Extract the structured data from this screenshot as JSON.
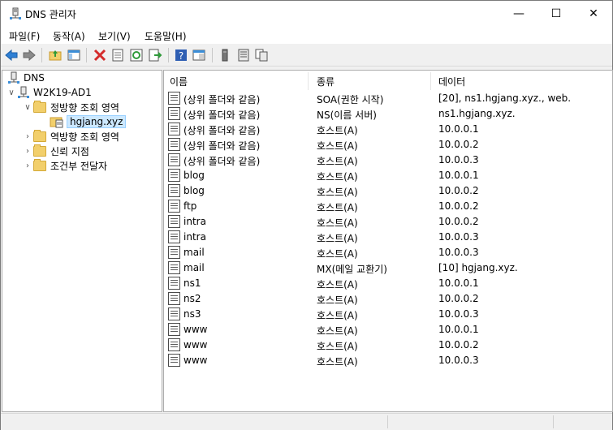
{
  "window": {
    "title": "DNS 관리자",
    "minimize": "—",
    "maximize": "☐",
    "close": "✕"
  },
  "menu": [
    "파일(F)",
    "동작(A)",
    "보기(V)",
    "도움말(H)"
  ],
  "toolbar": [
    "back-arrow-icon",
    "forward-arrow-icon",
    "up-folder-icon",
    "show-hide-tree-icon",
    "delete-icon",
    "properties-icon",
    "refresh-icon",
    "export-icon",
    "help-icon",
    "console-view-icon",
    "server-icon",
    "list-icon",
    "copy-icon"
  ],
  "tree": {
    "root": "DNS",
    "server": "W2K19-AD1",
    "forward": "정방향 조회 영역",
    "zone": "hgjang.xyz",
    "reverse": "역방향 조회 영역",
    "trust": "신뢰 지점",
    "conditional": "조건부 전달자"
  },
  "columns": {
    "name": "이름",
    "type": "종류",
    "data": "데이터"
  },
  "records": [
    {
      "name": "(상위 폴더와 같음)",
      "type": "SOA(권한 시작)",
      "data": "[20], ns1.hgjang.xyz., web."
    },
    {
      "name": "(상위 폴더와 같음)",
      "type": "NS(이름 서버)",
      "data": "ns1.hgjang.xyz."
    },
    {
      "name": "(상위 폴더와 같음)",
      "type": "호스트(A)",
      "data": "10.0.0.1"
    },
    {
      "name": "(상위 폴더와 같음)",
      "type": "호스트(A)",
      "data": "10.0.0.2"
    },
    {
      "name": "(상위 폴더와 같음)",
      "type": "호스트(A)",
      "data": "10.0.0.3"
    },
    {
      "name": "blog",
      "type": "호스트(A)",
      "data": "10.0.0.1"
    },
    {
      "name": "blog",
      "type": "호스트(A)",
      "data": "10.0.0.2"
    },
    {
      "name": "ftp",
      "type": "호스트(A)",
      "data": "10.0.0.2"
    },
    {
      "name": "intra",
      "type": "호스트(A)",
      "data": "10.0.0.2"
    },
    {
      "name": "intra",
      "type": "호스트(A)",
      "data": "10.0.0.3"
    },
    {
      "name": "mail",
      "type": "호스트(A)",
      "data": "10.0.0.3"
    },
    {
      "name": "mail",
      "type": "MX(메일 교환기)",
      "data": "[10]  hgjang.xyz."
    },
    {
      "name": "ns1",
      "type": "호스트(A)",
      "data": "10.0.0.1"
    },
    {
      "name": "ns2",
      "type": "호스트(A)",
      "data": "10.0.0.2"
    },
    {
      "name": "ns3",
      "type": "호스트(A)",
      "data": "10.0.0.3"
    },
    {
      "name": "www",
      "type": "호스트(A)",
      "data": "10.0.0.1"
    },
    {
      "name": "www",
      "type": "호스트(A)",
      "data": "10.0.0.2"
    },
    {
      "name": "www",
      "type": "호스트(A)",
      "data": "10.0.0.3"
    }
  ]
}
